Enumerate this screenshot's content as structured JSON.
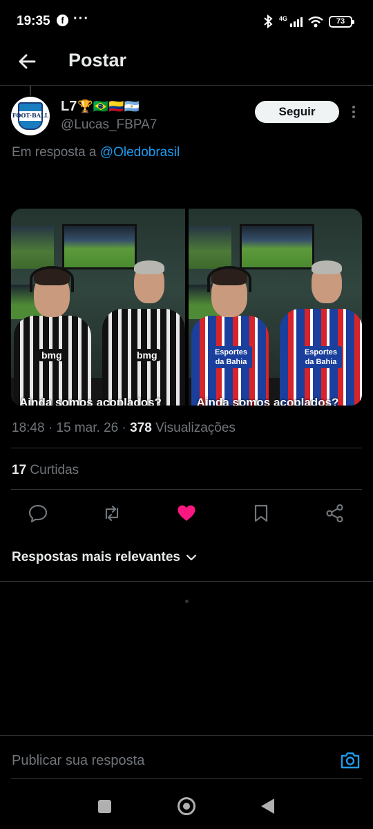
{
  "status_bar": {
    "time": "19:35",
    "notification_app": "f",
    "overflow": "···",
    "network": "4G",
    "battery": "73"
  },
  "header": {
    "title": "Postar"
  },
  "post": {
    "author": {
      "name": "L7",
      "name_emojis": "🏆🇧🇷🇨🇴🇦🇷",
      "handle": "@Lucas_FBPA7",
      "avatar_text": "FOOT·BALL"
    },
    "follow_label": "Seguir",
    "reply_prefix": "Em resposta a",
    "reply_to": "@Oledobrasil",
    "media": {
      "images": [
        {
          "sponsor": "bmg",
          "caption": "Ainda somos acoplados?"
        },
        {
          "sponsor": "Esportes da Bahia",
          "caption": "Ainda somos acoplados?"
        }
      ]
    },
    "timestamp": "18:48 · 15 mar. 26 · ",
    "views_count": "378",
    "views_label": "Visualizações",
    "likes_count": "17",
    "likes_label": "Curtidas"
  },
  "colors": {
    "accent": "#1d9bf0",
    "like": "#f91880",
    "muted": "#71767b"
  },
  "actions": [
    "reply-icon",
    "repost-icon",
    "like-icon",
    "bookmark-icon",
    "share-icon"
  ],
  "replies_sort": {
    "label": "Respostas mais relevantes"
  },
  "composer": {
    "placeholder": "Publicar sua resposta"
  }
}
